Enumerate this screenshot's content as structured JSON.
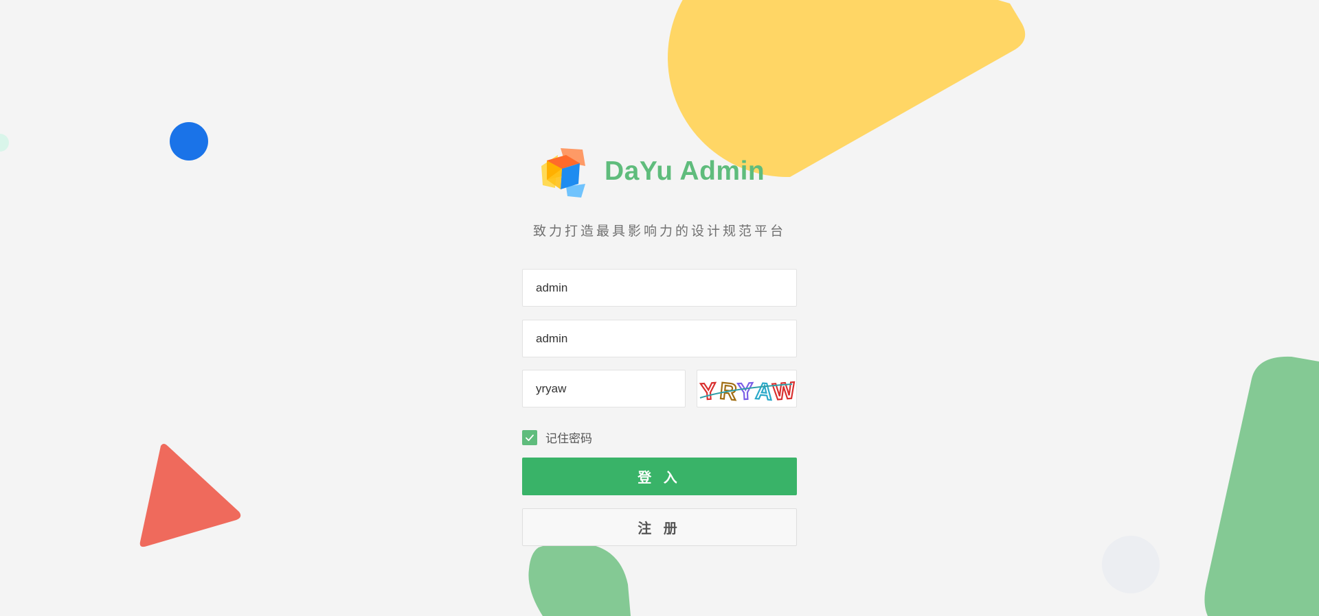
{
  "app": {
    "title": "DaYu Admin",
    "slogan": "致力打造最具影响力的设计规范平台"
  },
  "form": {
    "username": {
      "value": "admin"
    },
    "password": {
      "value": "admin"
    },
    "captcha": {
      "value": "yryaw",
      "image_text": "YRYAW"
    },
    "remember": {
      "label": "记住密码",
      "checked": true
    },
    "login_label": "登 入",
    "register_label": "注 册"
  },
  "colors": {
    "brand_green": "#5fbc7c",
    "primary_button": "#39b368",
    "background": "#f4f4f4",
    "deco_yellow": "#ffd665",
    "deco_blue": "#1a73e8",
    "deco_red": "#ef6a5c",
    "deco_green": "#84c994"
  },
  "icons": {
    "logo": "colorful-cube-logo",
    "checkbox": "checkmark-icon"
  }
}
